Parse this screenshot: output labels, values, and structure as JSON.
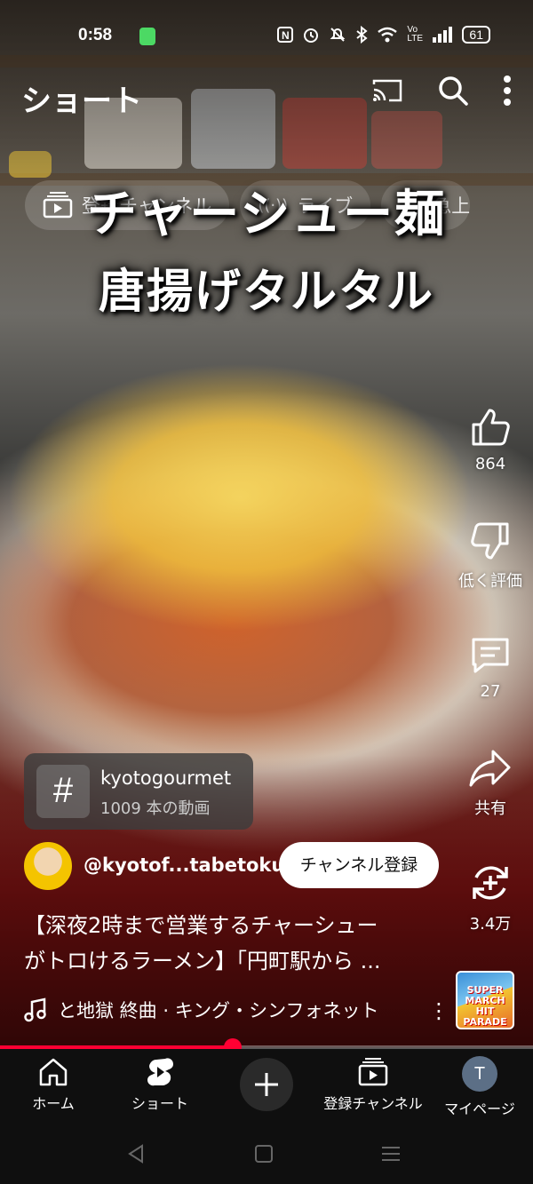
{
  "status_bar": {
    "time": "0:58",
    "right_icons": [
      "nfc-icon",
      "alarm-icon",
      "mute-icon",
      "bluetooth-icon",
      "wifi-icon",
      "volte-icon",
      "signal-icon"
    ],
    "volte": "Vo LTE",
    "battery": "61"
  },
  "top_bar": {
    "title": "ショート"
  },
  "chips": [
    {
      "icon": "subscriptions-icon",
      "label": "登録チャンネル"
    },
    {
      "icon": "live-icon",
      "label": "ライブ"
    },
    {
      "icon": "trending-icon",
      "label": "急上"
    }
  ],
  "video": {
    "caption_line1": "チャーシュー麺",
    "caption_line2": "唐揚げタルタル"
  },
  "actions": {
    "like_count": "864",
    "dislike_label": "低く評価",
    "comment_count": "27",
    "share_label": "共有",
    "remix_count": "3.4万"
  },
  "hashtag": {
    "symbol": "#",
    "name": "kyotogourmet",
    "count": "1009 本の動画"
  },
  "channel": {
    "handle": "@kyotof...tabetoku",
    "subscribe_label": "チャンネル登録"
  },
  "title": {
    "line1": "【深夜2時まで営業するチャーシュー",
    "line2": "がトロけるラーメン】「円町駅から ..."
  },
  "music": {
    "track": "と地獄 終曲 · キング・シンフォネット",
    "more": "⋮",
    "thumb_text": "SUPER MARCH HIT PARADE"
  },
  "progress": {
    "fraction": 0.436
  },
  "bottom_nav": [
    {
      "icon": "home-icon",
      "label": "ホーム"
    },
    {
      "icon": "shorts-icon",
      "label": "ショート"
    },
    {
      "icon": "create-icon",
      "label": ""
    },
    {
      "icon": "subscriptions-icon",
      "label": "登録チャンネル"
    },
    {
      "icon": "avatar",
      "label": "マイページ",
      "avatar_letter": "T"
    }
  ],
  "colors": {
    "accent": "#ff0033",
    "nav_bg": "#0f0f0f",
    "battery_saver": "#4cd964"
  }
}
